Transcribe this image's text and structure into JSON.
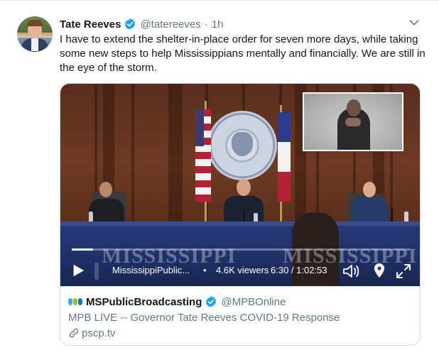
{
  "tweet": {
    "author_name": "Tate Reeves",
    "author_handle": "@tatereeves",
    "separator": "·",
    "time": "1h",
    "text": "I have to extend the shelter-in-place order for seven more days, while taking some new steps to help Mississippians mentally and financially. We are still in the eye of the storm."
  },
  "video": {
    "watermark_left": "MISSISSIPPI",
    "watermark_right": "MISSISSIPPI",
    "progress_fraction": 0.063,
    "source": "MississippiPublic...",
    "separator": "•",
    "viewers": "4.6K viewers",
    "time": "6:30 / 1:02:53",
    "icons": [
      "play-icon",
      "volume-icon",
      "location-pin-icon",
      "fullscreen-icon"
    ]
  },
  "link_card": {
    "account_name": "MSPublicBroadcasting",
    "account_handle": "@MPBOnline",
    "title": "MPB LIVE -- Governor Tate Reeves COVID-19 Response",
    "url": "pscp.tv"
  },
  "colors": {
    "verified_blue": "#1da1f2",
    "text_primary": "#14171a",
    "text_secondary": "#657786",
    "border": "#ccd6dd",
    "mpb_logo": [
      "#3fa9f5",
      "#8cc63f",
      "#1b75bc"
    ]
  }
}
